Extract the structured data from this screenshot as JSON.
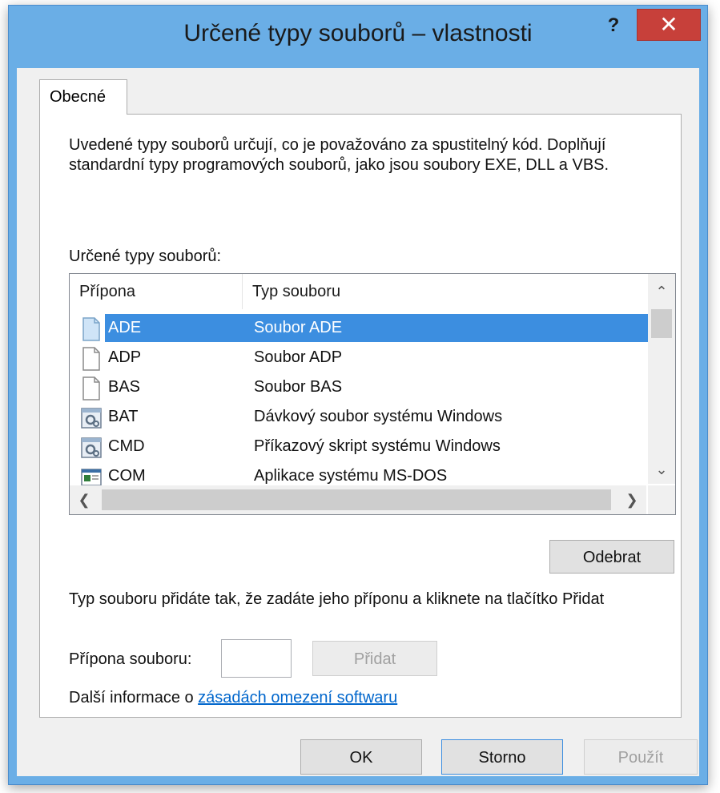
{
  "window": {
    "title": "Určené typy souborů – vlastnosti",
    "help_label": "?",
    "close_label": "✕"
  },
  "tabs": [
    {
      "label": "Obecné",
      "selected": true
    }
  ],
  "general": {
    "description": "Uvedené typy souborů určují, co je považováno za spustitelný kód. Doplňují standardní typy programových souborů, jako jsou soubory EXE, DLL a VBS.",
    "list_label": "Určené typy souborů:",
    "columns": {
      "extension": "Přípona",
      "type": "Typ souboru"
    },
    "rows": [
      {
        "ext": "ADE",
        "type": "Soubor ADE",
        "icon": "blank-file-icon",
        "selected": true
      },
      {
        "ext": "ADP",
        "type": "Soubor ADP",
        "icon": "blank-file-icon",
        "selected": false
      },
      {
        "ext": "BAS",
        "type": "Soubor BAS",
        "icon": "blank-file-icon",
        "selected": false
      },
      {
        "ext": "BAT",
        "type": "Dávkový soubor systému Windows",
        "icon": "batch-gear-icon",
        "selected": false
      },
      {
        "ext": "CMD",
        "type": "Příkazový skript systému Windows",
        "icon": "batch-gear-icon",
        "selected": false
      },
      {
        "ext": "COM",
        "type": "Aplikace systému MS-DOS",
        "icon": "dos-application-icon",
        "selected": false
      }
    ],
    "remove_label": "Odebrat",
    "help_text": "Typ souboru přidáte tak, že zadáte jeho příponu a kliknete na tlačítko Přidat",
    "extension_label": "Přípona souboru:",
    "extension_value": "",
    "add_label": "Přidat",
    "more_info_prefix": "Další informace o ",
    "more_info_link": "zásadách omezení softwaru"
  },
  "footer": {
    "ok_label": "OK",
    "cancel_label": "Storno",
    "apply_label": "Použít"
  },
  "colors": {
    "title_bar": "#6aaee6",
    "close_button": "#c7403a",
    "selection": "#3c8ee0",
    "link": "#0066cc"
  }
}
